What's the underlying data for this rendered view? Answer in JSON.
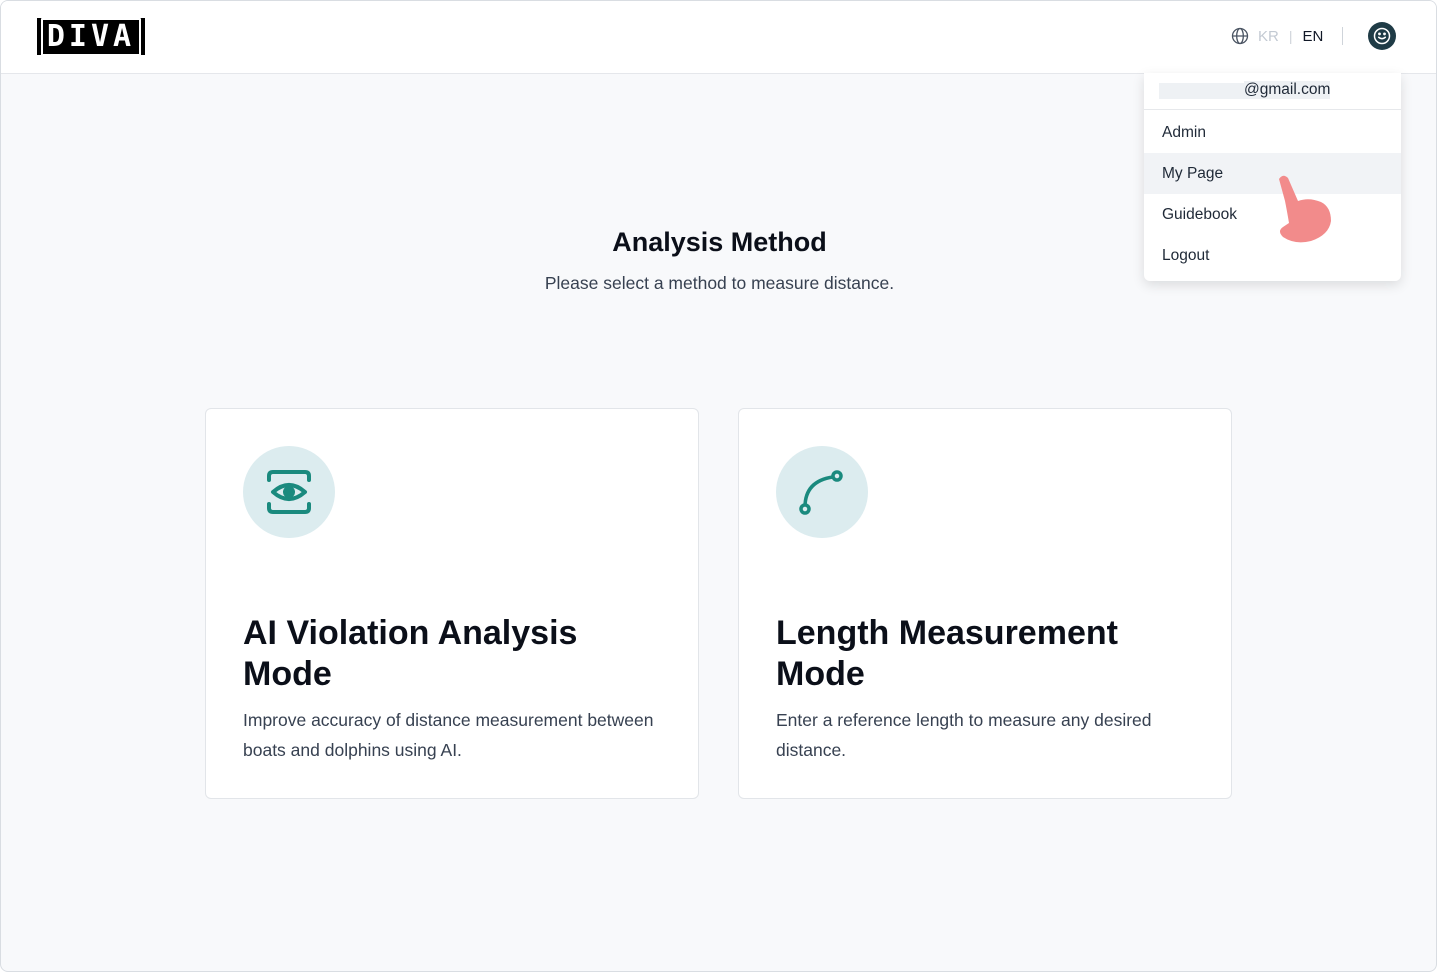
{
  "header": {
    "logo_text": "DIVA",
    "lang_kr": "KR",
    "lang_separator": "|",
    "lang_en": "EN",
    "globe_icon": "globe-icon",
    "avatar_icon": "smile-icon"
  },
  "dropdown": {
    "email": "@gmail.com",
    "items": [
      {
        "label": "Admin"
      },
      {
        "label": "My Page"
      },
      {
        "label": "Guidebook"
      },
      {
        "label": "Logout"
      }
    ],
    "pointer_icon": "hand-pointer-icon"
  },
  "main": {
    "title": "Analysis Method",
    "subtitle": "Please select a method to measure distance."
  },
  "cards": [
    {
      "icon": "eye-scan-icon",
      "title": "AI Violation Analysis Mode",
      "description": "Improve accuracy of distance measurement between boats and dolphins using AI."
    },
    {
      "icon": "curve-path-icon",
      "title": "Length Measurement Mode",
      "description": "Enter a reference length to measure any desired distance."
    }
  ],
  "colors": {
    "accent": "#1a8a7e",
    "icon_bg": "#dcecef",
    "page_bg": "#f8f9fb",
    "avatar_bg": "#1f3b46",
    "pointer": "#f28b8b"
  }
}
